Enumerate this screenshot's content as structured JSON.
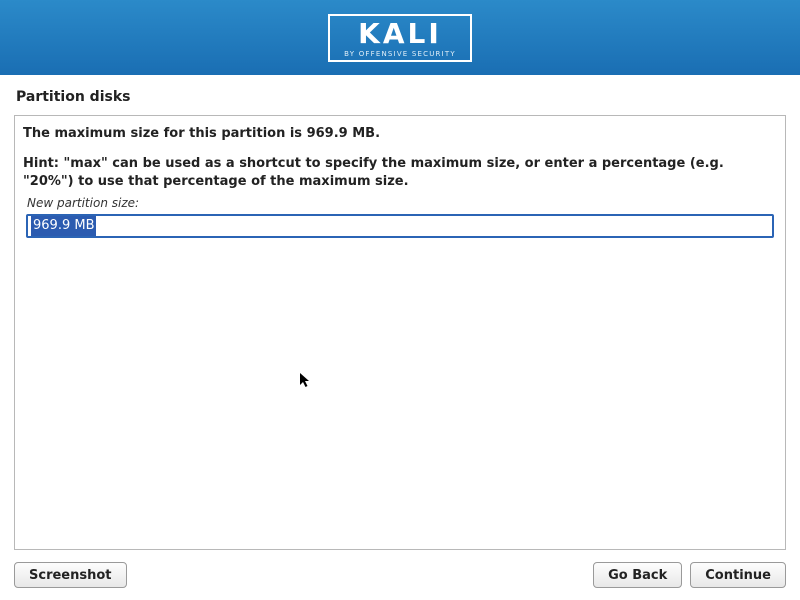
{
  "header": {
    "logo_text": "KALI",
    "logo_sub": "BY OFFENSIVE SECURITY"
  },
  "page": {
    "title": "Partition disks",
    "max_size_line": "The maximum size for this partition is 969.9 MB.",
    "hint_line": "Hint: \"max\" can be used as a shortcut to specify the maximum size, or enter a percentage (e.g. \"20%\") to use that percentage of the maximum size.",
    "field_label": "New partition size:",
    "input_value": "969.9 MB"
  },
  "buttons": {
    "screenshot": "Screenshot",
    "go_back": "Go Back",
    "continue": "Continue"
  }
}
